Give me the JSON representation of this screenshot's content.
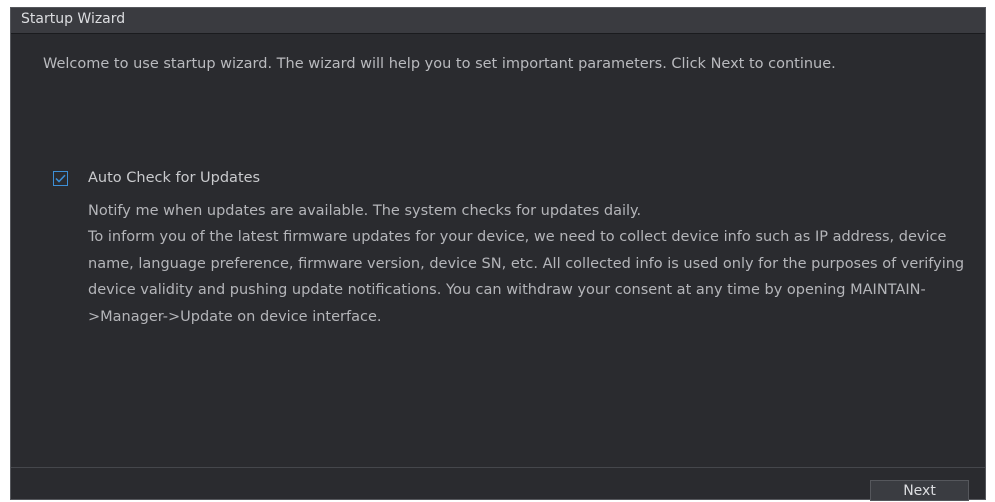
{
  "window": {
    "title": "Startup Wizard"
  },
  "welcome_text": "Welcome to use startup wizard. The wizard will help you to set important parameters. Click Next to continue.",
  "auto_update": {
    "label": "Auto Check for Updates",
    "checked": true,
    "notice_line1": "Notify me when updates are available. The system checks for updates daily.",
    "notice_line2": "To inform you of the latest firmware updates for your device, we need to collect device info such as IP address, device name, language preference, firmware version, device SN, etc. All collected info is used only for the purposes of verifying device validity and pushing update notifications. You can withdraw your consent at any time by opening MAINTAIN->Manager->Update on device interface."
  },
  "footer": {
    "next_label": "Next"
  },
  "colors": {
    "background": "#2a2b2f",
    "checkbox_accent": "#3d8fd6",
    "text": "#b9babe"
  },
  "icons": {
    "checkbox": "checkmark-icon"
  }
}
